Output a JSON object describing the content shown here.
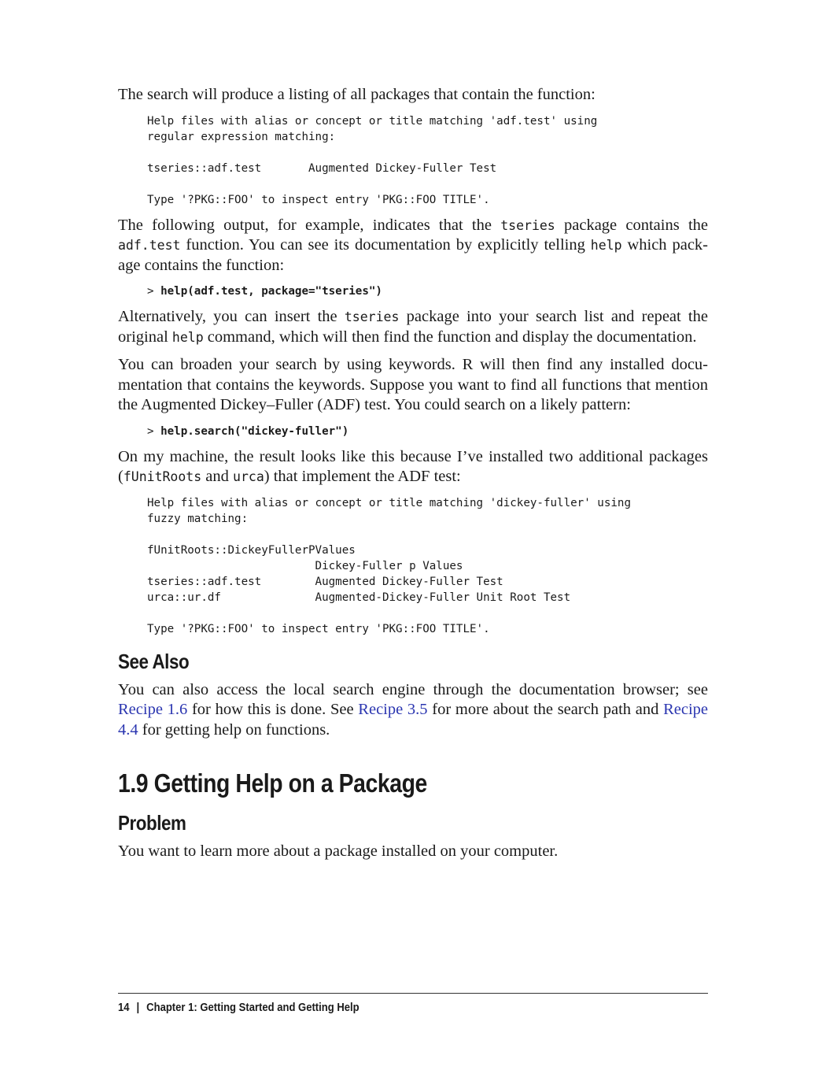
{
  "intro_para": "The search will produce a listing of all packages that contain the function:",
  "code_block_1": "Help files with alias or concept or title matching 'adf.test' using\nregular expression matching:\n\ntseries::adf.test       Augmented Dickey-Fuller Test\n\nType '?PKG::FOO' to inspect entry 'PKG::FOO TITLE'.",
  "para_2": {
    "t1": "The following output, for example, indicates that the ",
    "c1": "tseries",
    "t2": " package contains the ",
    "c2": "adf.test",
    "t3": " function. You can see its documentation by explicitly telling ",
    "c3": "help",
    "t4": " which pack-age contains the function:"
  },
  "cmd_1_prompt": "> ",
  "cmd_1": "help(adf.test, package=\"tseries\")",
  "para_3": {
    "t1": "Alternatively, you can insert the ",
    "c1": "tseries",
    "t2": " package into your search list and repeat the original ",
    "c2": "help",
    "t3": " command, which will then find the function and display the documentation."
  },
  "para_4": "You can broaden your search by using keywords. R will then find any installed docu-mentation that contains the keywords. Suppose you want to find all functions that mention the Augmented Dickey–Fuller (ADF) test. You could search on a likely pattern:",
  "cmd_2_prompt": "> ",
  "cmd_2": "help.search(\"dickey-fuller\")",
  "para_5": {
    "t1": "On my machine, the result looks like this because I’ve installed two additional packages (",
    "c1": "fUnitRoots",
    "t2": " and ",
    "c2": "urca",
    "t3": ") that implement the ADF test:"
  },
  "code_block_2": "Help files with alias or concept or title matching 'dickey-fuller' using\nfuzzy matching:\n\nfUnitRoots::DickeyFullerPValues\n                         Dickey-Fuller p Values\ntseries::adf.test        Augmented Dickey-Fuller Test\nurca::ur.df              Augmented-Dickey-Fuller Unit Root Test\n\nType '?PKG::FOO' to inspect entry 'PKG::FOO TITLE'.",
  "see_also_heading": "See Also",
  "see_also_para": {
    "t1": "You can also access the local search engine through the documentation browser; see ",
    "link1": "Recipe 1.6",
    "t2": " for how this is done. See ",
    "link2": "Recipe 3.5",
    "t3": " for more about the search path and ",
    "link3": "Recipe 4.4",
    "t4": " for getting help on functions."
  },
  "section_heading": "1.9  Getting Help on a Package",
  "problem_heading": "Problem",
  "problem_para": "You want to learn more about a package installed on your computer.",
  "footer": {
    "page_number": "14",
    "separator": "|",
    "chapter": "Chapter 1:  Getting Started and Getting Help"
  },
  "colors": {
    "link": "#2a35b0",
    "text": "#1a1a1a"
  }
}
